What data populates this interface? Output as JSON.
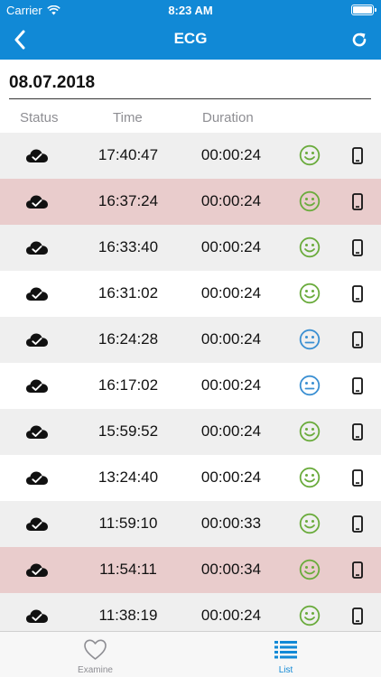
{
  "status_bar": {
    "carrier": "Carrier",
    "time": "8:23 AM"
  },
  "nav": {
    "title": "ECG",
    "back_icon": "chevron-left-icon",
    "refresh_icon": "refresh-icon"
  },
  "date": "08.07.2018",
  "columns": {
    "status": "Status",
    "time": "Time",
    "duration": "Duration"
  },
  "colors": {
    "accent": "#1189d6",
    "good": "#6aab3c",
    "neutral": "#3a8fd2",
    "flag_row": "#e9cccc",
    "alt_row": "#efefef"
  },
  "records": [
    {
      "time": "17:40:47",
      "duration": "00:00:24",
      "mood": "happy",
      "flagged": false
    },
    {
      "time": "16:37:24",
      "duration": "00:00:24",
      "mood": "happy",
      "flagged": true
    },
    {
      "time": "16:33:40",
      "duration": "00:00:24",
      "mood": "happy",
      "flagged": false
    },
    {
      "time": "16:31:02",
      "duration": "00:00:24",
      "mood": "happy",
      "flagged": false
    },
    {
      "time": "16:24:28",
      "duration": "00:00:24",
      "mood": "neutral",
      "flagged": false
    },
    {
      "time": "16:17:02",
      "duration": "00:00:24",
      "mood": "neutral",
      "flagged": false
    },
    {
      "time": "15:59:52",
      "duration": "00:00:24",
      "mood": "happy",
      "flagged": false
    },
    {
      "time": "13:24:40",
      "duration": "00:00:24",
      "mood": "happy",
      "flagged": false
    },
    {
      "time": "11:59:10",
      "duration": "00:00:33",
      "mood": "happy",
      "flagged": false
    },
    {
      "time": "11:54:11",
      "duration": "00:00:34",
      "mood": "happy",
      "flagged": true
    },
    {
      "time": "11:38:19",
      "duration": "00:00:24",
      "mood": "happy",
      "flagged": false
    }
  ],
  "tabs": [
    {
      "label": "Examine",
      "icon": "heart-icon",
      "active": false
    },
    {
      "label": "List",
      "icon": "list-icon",
      "active": true
    }
  ]
}
